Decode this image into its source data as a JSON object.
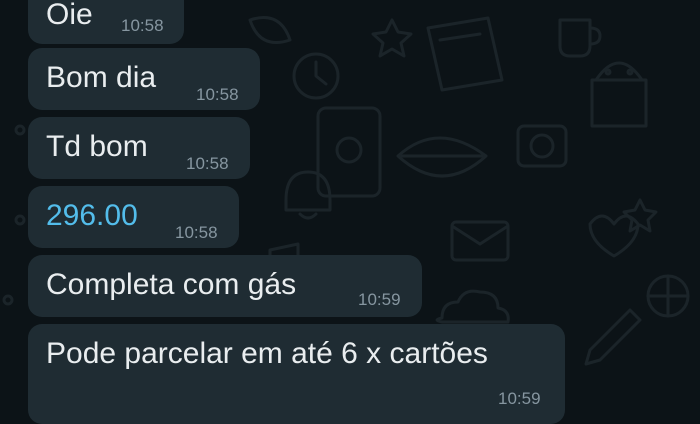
{
  "messages": [
    {
      "text": "Oie",
      "time": "10:58"
    },
    {
      "text": "Bom dia",
      "time": "10:58"
    },
    {
      "text": "Td bom",
      "time": "10:58"
    },
    {
      "text": "296.00",
      "time": "10:58"
    },
    {
      "text": "Completa com gás",
      "time": "10:59"
    },
    {
      "text": "Pode parcelar em até 6 x cartões",
      "time": "10:59"
    }
  ],
  "colors": {
    "background": "#0c1317",
    "bubble": "#1f2c33",
    "text": "#e9edef",
    "timestamp": "#8696a0",
    "link": "#53bdeb"
  }
}
